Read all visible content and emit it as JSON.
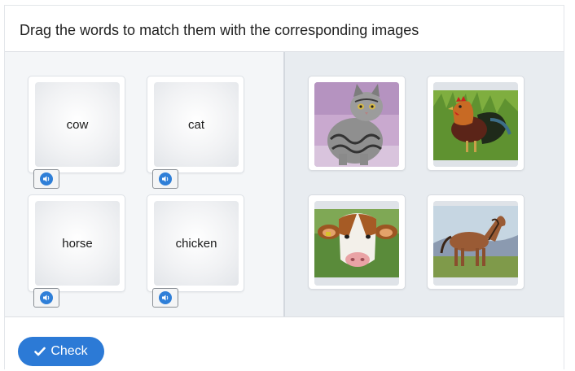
{
  "header": {
    "instruction": "Drag the words to match them with the corresponding images"
  },
  "words": [
    {
      "label": "cow",
      "audio_icon": "speaker-icon"
    },
    {
      "label": "cat",
      "audio_icon": "speaker-icon"
    },
    {
      "label": "horse",
      "audio_icon": "speaker-icon"
    },
    {
      "label": "chicken",
      "audio_icon": "speaker-icon"
    }
  ],
  "images": [
    {
      "subject": "cat"
    },
    {
      "subject": "chicken"
    },
    {
      "subject": "cow"
    },
    {
      "subject": "horse"
    }
  ],
  "footer": {
    "check_label": "Check",
    "check_icon": "checkmark-icon"
  },
  "colors": {
    "accent": "#2c7ad6",
    "left_pane_bg": "#f4f6f8",
    "right_pane_bg": "#e8ecf0"
  }
}
